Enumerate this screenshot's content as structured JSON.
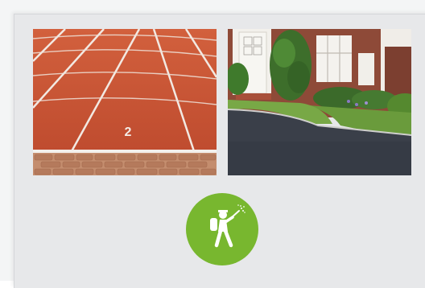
{
  "colors": {
    "page_background": "#f4f5f6",
    "card_background": "#e7e8ea",
    "badge_green": "#78b72f",
    "track_red": "#c95436",
    "asphalt": "#3a3f49"
  },
  "gallery": {
    "images": [
      {
        "subject": "running-track-with-paving",
        "lane_marking": "2"
      },
      {
        "subject": "house-with-asphalt-driveway"
      }
    ]
  },
  "service_badge": {
    "icon": "pest-control-sprayer-icon"
  }
}
